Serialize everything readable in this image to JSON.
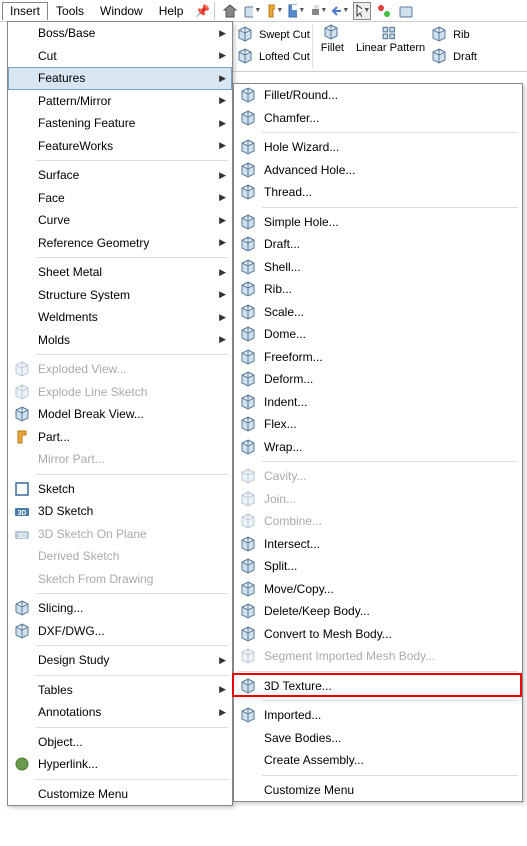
{
  "menubar": {
    "items": [
      "Insert",
      "Tools",
      "Window",
      "Help"
    ]
  },
  "ribbon": {
    "swept_cut": "Swept Cut",
    "lofted_cut": "Lofted Cut",
    "fillet": "Fillet",
    "linear_pattern": "Linear Pattern",
    "rib": "Rib",
    "draft": "Draft"
  },
  "menu1": {
    "items": [
      {
        "label": "Boss/Base",
        "arrow": true
      },
      {
        "label": "Cut",
        "arrow": true
      },
      {
        "label": "Features",
        "arrow": true,
        "hover": true
      },
      {
        "label": "Pattern/Mirror",
        "arrow": true
      },
      {
        "label": "Fastening Feature",
        "arrow": true
      },
      {
        "label": "FeatureWorks",
        "arrow": true
      },
      {
        "sep": true
      },
      {
        "label": "Surface",
        "arrow": true
      },
      {
        "label": "Face",
        "arrow": true
      },
      {
        "label": "Curve",
        "arrow": true
      },
      {
        "label": "Reference Geometry",
        "arrow": true
      },
      {
        "sep": true
      },
      {
        "label": "Sheet Metal",
        "arrow": true
      },
      {
        "label": "Structure System",
        "arrow": true
      },
      {
        "label": "Weldments",
        "arrow": true
      },
      {
        "label": "Molds",
        "arrow": true
      },
      {
        "sep": true
      },
      {
        "label": "Exploded View...",
        "disabled": true,
        "icon": "explode"
      },
      {
        "label": "Explode Line Sketch",
        "disabled": true,
        "icon": "explode-line"
      },
      {
        "label": "Model Break View...",
        "icon": "break"
      },
      {
        "label": "Part...",
        "icon": "part"
      },
      {
        "label": "Mirror Part...",
        "disabled": true
      },
      {
        "sep": true
      },
      {
        "label": "Sketch",
        "icon": "sketch"
      },
      {
        "label": "3D Sketch",
        "icon": "sketch3d"
      },
      {
        "label": "3D Sketch On Plane",
        "disabled": true,
        "icon": "sketch3d"
      },
      {
        "label": "Derived Sketch",
        "disabled": true
      },
      {
        "label": "Sketch From Drawing",
        "disabled": true
      },
      {
        "sep": true
      },
      {
        "label": "Slicing...",
        "icon": "slice"
      },
      {
        "label": "DXF/DWG...",
        "icon": "dxf"
      },
      {
        "sep": true
      },
      {
        "label": "Design Study",
        "arrow": true
      },
      {
        "sep": true
      },
      {
        "label": "Tables",
        "arrow": true
      },
      {
        "label": "Annotations",
        "arrow": true
      },
      {
        "sep": true
      },
      {
        "label": "Object..."
      },
      {
        "label": "Hyperlink...",
        "icon": "link"
      },
      {
        "sep": true
      },
      {
        "label": "Customize Menu"
      }
    ]
  },
  "menu2": {
    "items": [
      {
        "label": "Fillet/Round...",
        "icon": "fillet"
      },
      {
        "label": "Chamfer...",
        "icon": "chamfer"
      },
      {
        "sep": true
      },
      {
        "label": "Hole Wizard...",
        "icon": "hole"
      },
      {
        "label": "Advanced Hole...",
        "icon": "hole2"
      },
      {
        "label": "Thread...",
        "icon": "thread"
      },
      {
        "sep": true
      },
      {
        "label": "Simple Hole...",
        "icon": "hole3"
      },
      {
        "label": "Draft...",
        "icon": "draft"
      },
      {
        "label": "Shell...",
        "icon": "shell"
      },
      {
        "label": "Rib...",
        "icon": "rib"
      },
      {
        "label": "Scale...",
        "icon": "scale"
      },
      {
        "label": "Dome...",
        "icon": "dome"
      },
      {
        "label": "Freeform...",
        "icon": "freeform"
      },
      {
        "label": "Deform...",
        "icon": "deform"
      },
      {
        "label": "Indent...",
        "icon": "indent"
      },
      {
        "label": "Flex...",
        "icon": "flex"
      },
      {
        "label": "Wrap...",
        "icon": "wrap"
      },
      {
        "sep": true
      },
      {
        "label": "Cavity...",
        "disabled": true,
        "icon": "cavity"
      },
      {
        "label": "Join...",
        "disabled": true,
        "icon": "join"
      },
      {
        "label": "Combine...",
        "disabled": true,
        "icon": "combine"
      },
      {
        "label": "Intersect...",
        "icon": "intersect"
      },
      {
        "label": "Split...",
        "icon": "split"
      },
      {
        "label": "Move/Copy...",
        "icon": "move"
      },
      {
        "label": "Delete/Keep Body...",
        "icon": "delete"
      },
      {
        "label": "Convert to Mesh Body...",
        "icon": "mesh"
      },
      {
        "label": "Segment Imported Mesh Body...",
        "disabled": true,
        "icon": "mesh2"
      },
      {
        "sep": true,
        "full": true
      },
      {
        "label": "3D Texture...",
        "icon": "texture",
        "highlight": true
      },
      {
        "sep": true
      },
      {
        "label": "Imported...",
        "icon": "import"
      },
      {
        "label": "Save Bodies..."
      },
      {
        "label": "Create Assembly..."
      },
      {
        "sep": true
      },
      {
        "label": "Customize Menu"
      }
    ]
  }
}
